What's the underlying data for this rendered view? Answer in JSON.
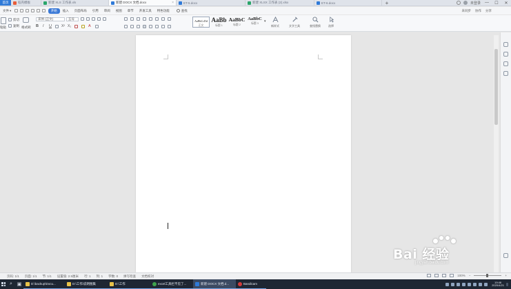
{
  "tabbar": {
    "home_label": "首页",
    "tabs": [
      {
        "label": "稻壳模板",
        "color": "#e85d3a",
        "active": false
      },
      {
        "label": "新建 XLS 工作表.xls",
        "color": "#2aa66a",
        "active": false
      },
      {
        "label": "新建 DOCX 文档.docx",
        "color": "#2f7ad8",
        "active": true
      },
      {
        "label": "ET-5.docx",
        "color": "#2f7ad8",
        "active": false
      },
      {
        "label": "新建 XLSX 工作表 (2).xlsx",
        "color": "#2aa66a",
        "active": false
      },
      {
        "label": "ET-6.docx",
        "color": "#2f7ad8",
        "active": false
      }
    ],
    "add_label": "+",
    "user_label": "未登录",
    "window_controls": [
      "—",
      "☐",
      "✕"
    ]
  },
  "menubar": {
    "file_label": "文件",
    "items": [
      {
        "label": "开始",
        "active": true
      },
      {
        "label": "插入",
        "active": false
      },
      {
        "label": "页面布局",
        "active": false
      },
      {
        "label": "引用",
        "active": false
      },
      {
        "label": "审阅",
        "active": false
      },
      {
        "label": "视图",
        "active": false
      },
      {
        "label": "章节",
        "active": false
      },
      {
        "label": "开发工具",
        "active": false
      },
      {
        "label": "特色功能",
        "active": false
      }
    ],
    "search_label": "查找",
    "right": [
      "未同步",
      "协作",
      "分享"
    ]
  },
  "ribbon": {
    "paste_label": "粘贴",
    "cut_label": "剪切",
    "copy_label": "复制",
    "format_painter_label": "格式刷",
    "font_name": "宋体 (正文)",
    "font_size": "五号",
    "styles": [
      {
        "sample": "AaBbCcDd",
        "label": "正文",
        "selected": true
      },
      {
        "sample": "AaBb",
        "label": "标题 1",
        "selected": false
      },
      {
        "sample": "AaBbC",
        "label": "标题 2",
        "selected": false
      },
      {
        "sample": "AaBbC",
        "label": "标题 3",
        "selected": false
      }
    ],
    "new_style_label": "新样式",
    "text_tools_label": "文字工具",
    "find_replace_label": "查找替换",
    "select_label": "选择"
  },
  "statusbar": {
    "items": [
      "页码: 1/1",
      "页面: 1/1",
      "节: 1/1",
      "设置值: 2.5厘米",
      "行: 1",
      "列: 1",
      "字数: 0",
      "拼写检查",
      "文档校对"
    ],
    "zoom": "100%"
  },
  "taskbar": {
    "tasks": [
      {
        "label": "D:\\backup\\Docu...",
        "color": "#e8c24a",
        "active": false
      },
      {
        "label": "D:\\工作\\说明图集",
        "color": "#e8c24a",
        "active": false
      },
      {
        "label": "D:\\工作",
        "color": "#e8c24a",
        "active": false
      },
      {
        "label": "excel工具栏不见了...",
        "color": "#3fa34d",
        "active": false
      },
      {
        "label": "新建 DOCX 文档.d...",
        "color": "#2f7ad8",
        "active": true
      },
      {
        "label": "Bandicam",
        "color": "#d23b3b",
        "active": false
      }
    ],
    "clock_time": "19:46",
    "clock_date": "2020/4/21"
  },
  "watermark": {
    "text": "Bai 经验",
    "sub": "jingyan.baidu.com"
  }
}
